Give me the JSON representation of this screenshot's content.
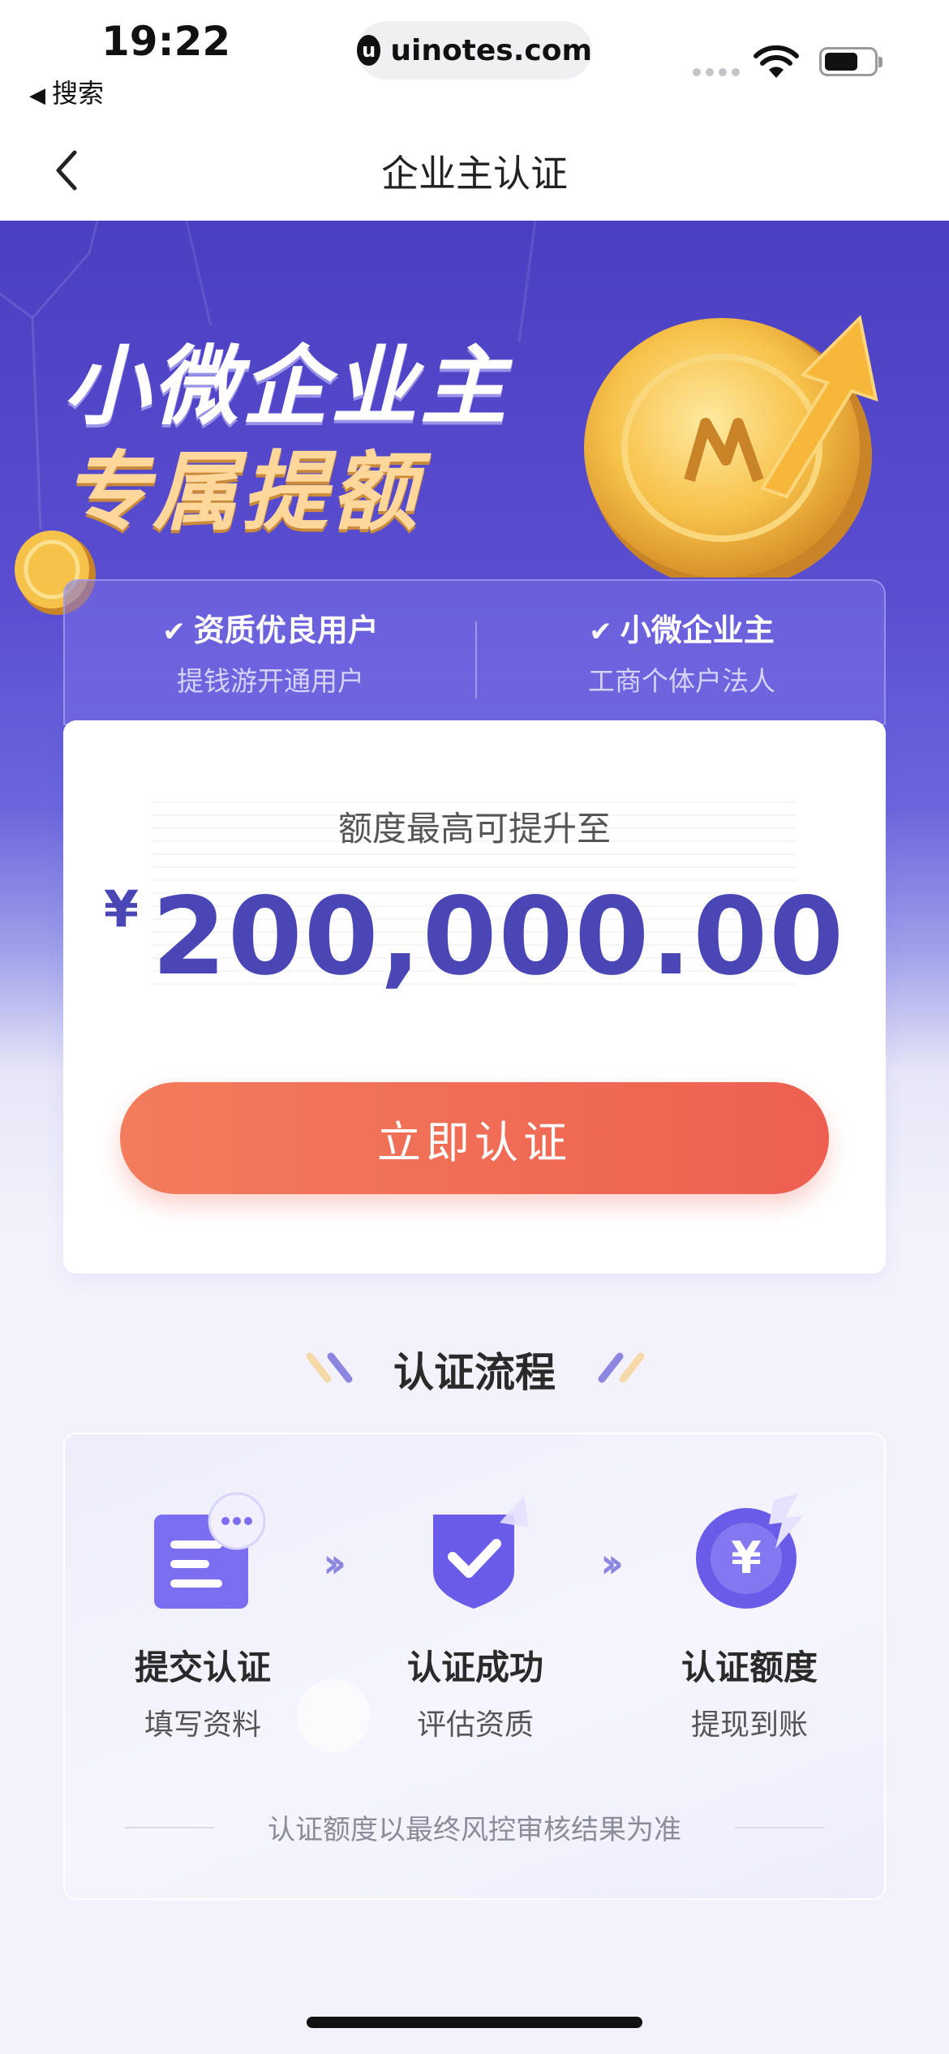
{
  "status_bar": {
    "time": "19:22",
    "back_app": "搜索",
    "url": "uinotes.com"
  },
  "nav": {
    "title": "企业主认证"
  },
  "hero": {
    "line1": "小微企业主",
    "line2": "专属提额"
  },
  "features": [
    {
      "title": "资质优良用户",
      "sub": "提钱游开通用户"
    },
    {
      "title": "小微企业主",
      "sub": "工商个体户法人"
    }
  ],
  "amount": {
    "label": "额度最高可提升至",
    "currency": "¥",
    "value": "200,000.00"
  },
  "cta": {
    "label": "立即认证"
  },
  "process": {
    "title": "认证流程",
    "steps": [
      {
        "title": "提交认证",
        "sub": "填写资料",
        "icon": "document-chat-icon"
      },
      {
        "title": "认证成功",
        "sub": "评估资质",
        "icon": "shield-check-icon"
      },
      {
        "title": "认证额度",
        "sub": "提现到账",
        "icon": "yen-coin-icon"
      }
    ],
    "note": "认证额度以最终风控审核结果为准"
  },
  "colors": {
    "brand": "#4b46b5",
    "cta": "#ee5f50",
    "hero_top": "#4a3fc1"
  }
}
